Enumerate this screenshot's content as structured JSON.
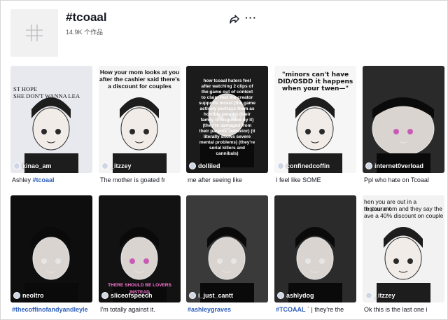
{
  "header": {
    "title": "#tcoaal",
    "subtitle": "14.9K 个作品",
    "avatar_icon": "hashtag-icon",
    "share_icon": "share-icon",
    "more_icon": "more-icon",
    "more_glyph": "···"
  },
  "videos": [
    {
      "overlay_lines": [
        "ST HOPE",
        "SHE DON'T WANNA LEA"
      ],
      "author": "kinao_am",
      "desc_plain": "Ashley ",
      "desc_tag": "#tcoaal",
      "bg": "#e8e8ef"
    },
    {
      "overlay_lines": [
        "How your mom looks at you",
        "after the cashier said there's",
        "a discount for couples"
      ],
      "author": "_itzzey",
      "desc_plain": "The mother is goated fr",
      "desc_tag": "",
      "bg": "#f4f4f4"
    },
    {
      "overlay_lines": [
        "how tcoaal haters feel",
        "after watching 2 clips of",
        "the game out of context",
        "to claim that the creator",
        "supports incest (the game",
        "actively portrays them as",
        "horrible people) (their",
        "family is disgusted by it)",
        "(they're damaged from",
        "their parents' behavior) (it",
        "literally shows severe",
        "mental problems) (they're",
        "serial killers and",
        "cannibals)"
      ],
      "author": "dolliied",
      "desc_plain": "me after seeing like",
      "desc_tag": "",
      "bg": "#1b1b1b"
    },
    {
      "overlay_lines": [
        "\"minors can't have",
        "DID/OSDD it happens",
        "when your twen—\""
      ],
      "author": "confinedcoffin",
      "desc_plain": "I feel like SOME",
      "desc_tag": "",
      "bg": "#f6f6f6"
    },
    {
      "overlay_lines": [],
      "author": "internet0verload",
      "desc_plain": "Ppl who hate on Tcoaal",
      "desc_tag": "",
      "bg": "#2a2a2a"
    },
    {
      "overlay_lines": [],
      "author": "neoltro",
      "desc_plain": "",
      "desc_tag": "#thecoffinofandyandleyle",
      "bg": "#0e0e0e"
    },
    {
      "overlay_lines": [
        "THERE SHOULD BE LOVERS INSTEAD"
      ],
      "author": "sliceofspeech",
      "desc_plain": "I'm totally against it.",
      "desc_tag": "",
      "bg": "#121212"
    },
    {
      "overlay_lines": [],
      "author": "i_just_cantt",
      "desc_plain": "",
      "desc_tag": "#ashleygraves",
      "bg": "#3a3a3a"
    },
    {
      "overlay_lines": [],
      "author": "ashlydog",
      "desc_plain": " ` | they're the",
      "desc_tag": "#TCOAAL",
      "bg": "#2b2b2b"
    },
    {
      "overlay_lines": [
        "hen you are out in a restaurant",
        "th your mom and they say the",
        "ave a 40% discount on couple"
      ],
      "author": "_itzzey",
      "desc_plain": "Ok this is the last one i",
      "desc_tag": "",
      "bg": "#f2f2f2"
    }
  ]
}
